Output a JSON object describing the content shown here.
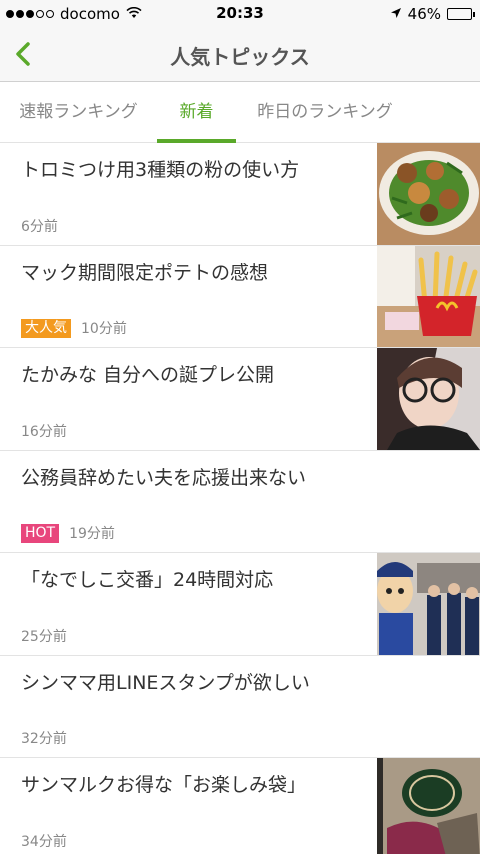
{
  "status_bar": {
    "carrier": "docomo",
    "time": "20:33",
    "battery": "46%",
    "battery_level": 0.46,
    "icons": [
      "signal-icon",
      "wifi-icon",
      "location-arrow-icon",
      "battery-icon"
    ]
  },
  "nav": {
    "title": "人気トピックス",
    "back_icon": "chevron-left-icon"
  },
  "tabs": [
    {
      "label": "速報ランキング",
      "active": false
    },
    {
      "label": "新着",
      "active": true
    },
    {
      "label": "昨日のランキング",
      "active": false
    }
  ],
  "colors": {
    "accent": "#5aa92a",
    "badge_popular": "#f39a1f",
    "badge_hot": "#e8467c"
  },
  "items": [
    {
      "title": "トロミつけ用3種類の粉の使い方",
      "time": "6分前",
      "badge": "",
      "thumbnail": "food-plate-thumbnail"
    },
    {
      "title": "マック期間限定ポテトの感想",
      "time": "10分前",
      "badge": "大人気",
      "thumbnail": "fries-thumbnail"
    },
    {
      "title": "たかみな 自分への誕プレ公開",
      "time": "16分前",
      "badge": "",
      "thumbnail": "portrait-glasses-thumbnail"
    },
    {
      "title": "公務員辞めたい夫を応援出来ない",
      "time": "19分前",
      "badge": "HOT",
      "thumbnail": ""
    },
    {
      "title": "「なでしこ交番」24時間対応",
      "time": "25分前",
      "badge": "",
      "thumbnail": "police-mascot-thumbnail"
    },
    {
      "title": "シンママ用LINEスタンプが欲しい",
      "time": "32分前",
      "badge": "",
      "thumbnail": ""
    },
    {
      "title": "サンマルクお得な「お楽しみ袋」",
      "time": "34分前",
      "badge": "",
      "thumbnail": "bag-thumbnail"
    }
  ]
}
